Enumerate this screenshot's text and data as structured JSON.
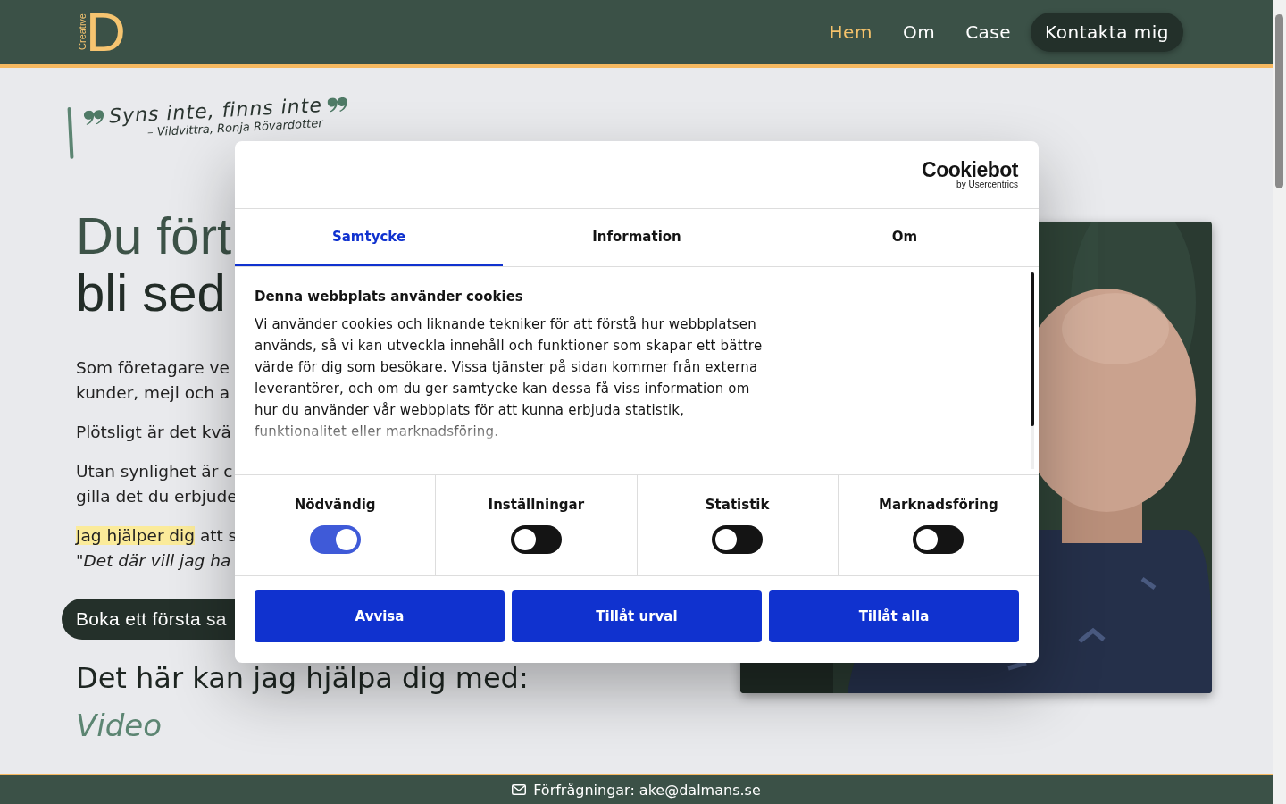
{
  "header": {
    "logo": {
      "word": "Creative",
      "letter": "D"
    },
    "nav": [
      {
        "label": "Hem",
        "selected": true,
        "kind": "link"
      },
      {
        "label": "Om",
        "selected": false,
        "kind": "link"
      },
      {
        "label": "Case",
        "selected": false,
        "kind": "link"
      },
      {
        "label": "Kontakta mig",
        "selected": false,
        "kind": "pill"
      }
    ]
  },
  "quote": {
    "text": "Syns inte, finns inte",
    "attribution": "– Vildvittra, Ronja Rövardotter"
  },
  "headline": [
    "Du fört",
    "bli sed"
  ],
  "paragraphs": [
    [
      [
        {
          "text": "Som företagare ve",
          "highlight": false
        }
      ],
      [
        {
          "text": "kunder, mejl och a",
          "highlight": false
        }
      ]
    ],
    [
      [
        {
          "text": "Plötsligt är det kvä",
          "highlight": false
        }
      ]
    ],
    [
      [
        {
          "text": "Utan synlighet är c",
          "highlight": false
        }
      ],
      [
        {
          "text": "gilla det du erbjude",
          "highlight": false
        }
      ]
    ],
    [
      [
        {
          "text": "Jag hjälper dig",
          "highlight": true
        },
        {
          "text": " att s",
          "highlight": false
        }
      ],
      [
        {
          "text": "\"*Det där vill jag ha*",
          "highlight": false
        }
      ]
    ]
  ],
  "cta": "Boka ett första sa",
  "services_heading": "Det här kan jag hjälpa dig med:",
  "service": "Video",
  "photo": {
    "kind": "picture"
  },
  "cookie_dialog": {
    "logo": {
      "name": "Cookiebot",
      "byline": "by Usercentrics"
    },
    "tabs": [
      {
        "label": "Samtycke",
        "selected": true
      },
      {
        "label": "Information",
        "selected": false
      },
      {
        "label": "Om",
        "selected": false
      }
    ],
    "title": "Denna webbplats använder cookies",
    "body": "Vi använder cookies och liknande tekniker för att förstå hur webbplatsen används, så vi kan utveckla innehåll och funktioner som skapar ett bättre värde för dig som besökare. Vissa tjänster på sidan kommer från externa leverantörer, och om du ger samtycke kan dessa få viss information om hur du använder vår webbplats för att kunna erbjuda statistik, funktionalitet eller marknadsföring.",
    "toggles": [
      {
        "label": "Nödvändig",
        "checked": true
      },
      {
        "label": "Inställningar",
        "checked": false
      },
      {
        "label": "Statistik",
        "checked": false
      },
      {
        "label": "Marknadsföring",
        "checked": false
      }
    ],
    "buttons": [
      "Avvisa",
      "Tillåt urval",
      "Tillåt alla"
    ]
  },
  "footer": {
    "text": "Förfrågningar: ake@dalmans.se"
  }
}
